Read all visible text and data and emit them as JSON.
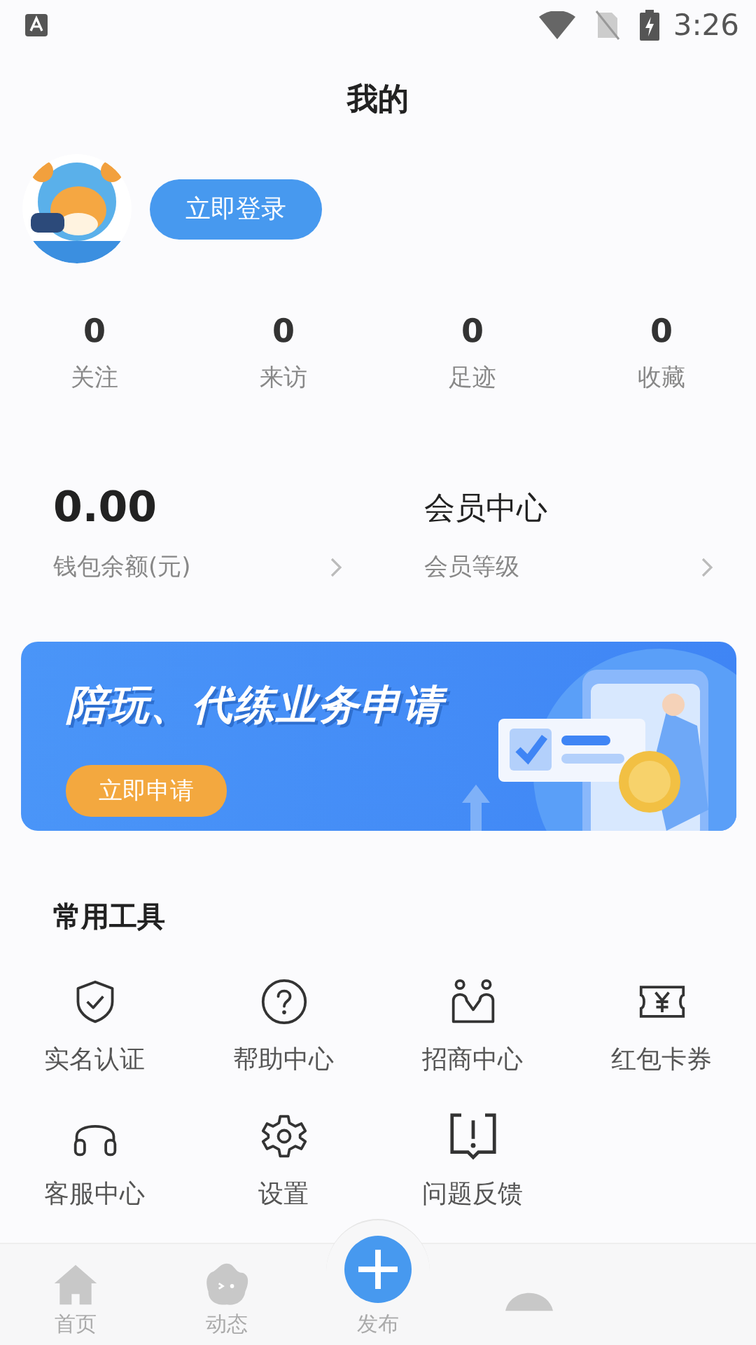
{
  "status_bar": {
    "time": "3:26"
  },
  "header": {
    "title": "我的"
  },
  "profile": {
    "login_button": "立即登录"
  },
  "stats": [
    {
      "value": "0",
      "label": "关注"
    },
    {
      "value": "0",
      "label": "来访"
    },
    {
      "value": "0",
      "label": "足迹"
    },
    {
      "value": "0",
      "label": "收藏"
    }
  ],
  "wallet": {
    "amount": "0.00",
    "label": "钱包余额(元)"
  },
  "membership": {
    "title": "会员中心",
    "label": "会员等级"
  },
  "banner": {
    "title": "陪玩、代练业务申请",
    "button": "立即申请"
  },
  "tools": {
    "title": "常用工具",
    "items": [
      {
        "kind": "shield",
        "label": "实名认证"
      },
      {
        "kind": "help",
        "label": "帮助中心"
      },
      {
        "kind": "people",
        "label": "招商中心"
      },
      {
        "kind": "coupon",
        "label": "红包卡券"
      },
      {
        "kind": "headset",
        "label": "客服中心"
      },
      {
        "kind": "gear",
        "label": "设置"
      },
      {
        "kind": "feedback",
        "label": "问题反馈"
      }
    ]
  },
  "tab_bar": [
    {
      "kind": "home",
      "label": "首页"
    },
    {
      "kind": "feed",
      "label": "动态"
    },
    {
      "kind": "publish",
      "label": "发布"
    },
    {
      "kind": "profile"
    }
  ]
}
